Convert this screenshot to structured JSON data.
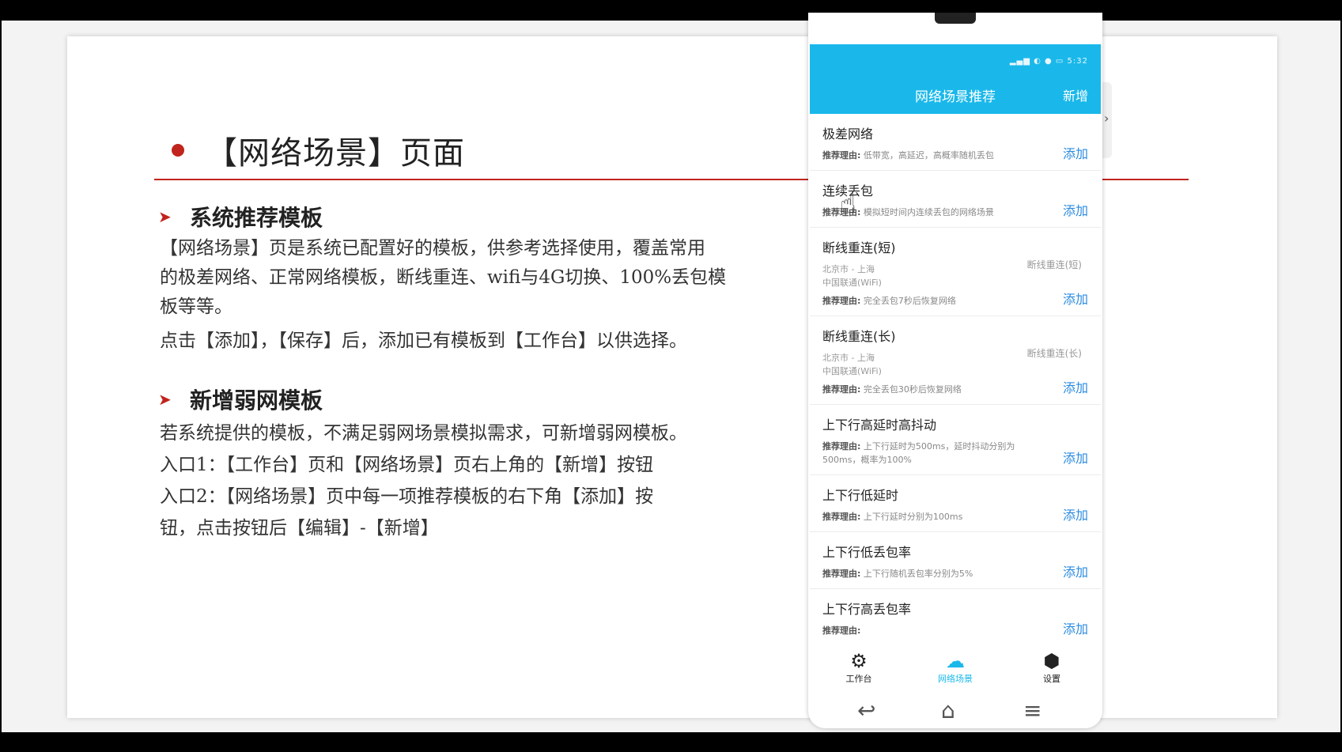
{
  "slide": {
    "title": "【网络场景】页面",
    "section1": {
      "heading": "系统推荐模板",
      "lines": [
        "【网络场景】页是系统已配置好的模板，供参考选择使用，覆盖常用",
        "的极差网络、正常网络模板，断线重连、wifi与4G切换、100%丢包模",
        "板等等。",
        "点击【添加】，【保存】后，添加已有模板到【工作台】以供选择。"
      ]
    },
    "section2": {
      "heading": "新增弱网模板",
      "lines": [
        "若系统提供的模板，不满足弱网场景模拟需求，可新增弱网模板。",
        "入口1：【工作台】页和【网络场景】页右上角的【新增】按钮",
        "入口2：【网络场景】页中每一项推荐模板的右下角【添加】按",
        "钮，点击按钮后【编辑】-【新增】"
      ]
    }
  },
  "phone": {
    "status_text": "5:32",
    "header_title": "网络场景推荐",
    "header_add": "新增",
    "reason_label": "推荐理由:",
    "items": [
      {
        "name": "极差网络",
        "route1": "",
        "route2": "",
        "right": "",
        "reason": "低带宽，高延迟，高概率随机丢包",
        "add": "添加"
      },
      {
        "name": "连续丢包",
        "route1": "",
        "route2": "",
        "right": "",
        "reason": "模拟短时间内连续丢包的网络场景",
        "add": "添加"
      },
      {
        "name": "断线重连(短)",
        "route1": "北京市 - 上海",
        "route2": "中国联通(WiFi)",
        "right": "断线重连(短)",
        "reason": "完全丢包7秒后恢复网络",
        "add": "添加"
      },
      {
        "name": "断线重连(长)",
        "route1": "北京市 - 上海",
        "route2": "中国联通(WiFi)",
        "right": "断线重连(长)",
        "reason": "完全丢包30秒后恢复网络",
        "add": "添加"
      },
      {
        "name": "上下行高延时高抖动",
        "route1": "",
        "route2": "",
        "right": "",
        "reason": "上下行延时为500ms，延时抖动分别为500ms，概率为100%",
        "add": "添加"
      },
      {
        "name": "上下行低延时",
        "route1": "",
        "route2": "",
        "right": "",
        "reason": "上下行延时分别为100ms",
        "add": "添加"
      },
      {
        "name": "上下行低丢包率",
        "route1": "",
        "route2": "",
        "right": "",
        "reason": "上下行随机丢包率分别为5%",
        "add": "添加"
      },
      {
        "name": "上下行高丢包率",
        "route1": "",
        "route2": "",
        "right": "",
        "reason": "",
        "add": "添加"
      }
    ],
    "tabs": [
      {
        "label": "工作台",
        "icon": "sliders-icon"
      },
      {
        "label": "网络场景",
        "icon": "cloud-icon"
      },
      {
        "label": "设置",
        "icon": "hex-gear-icon"
      }
    ]
  },
  "colors": {
    "accent": "#1ab8ea",
    "link": "#2a8be0",
    "title_red": "#c0241c"
  }
}
